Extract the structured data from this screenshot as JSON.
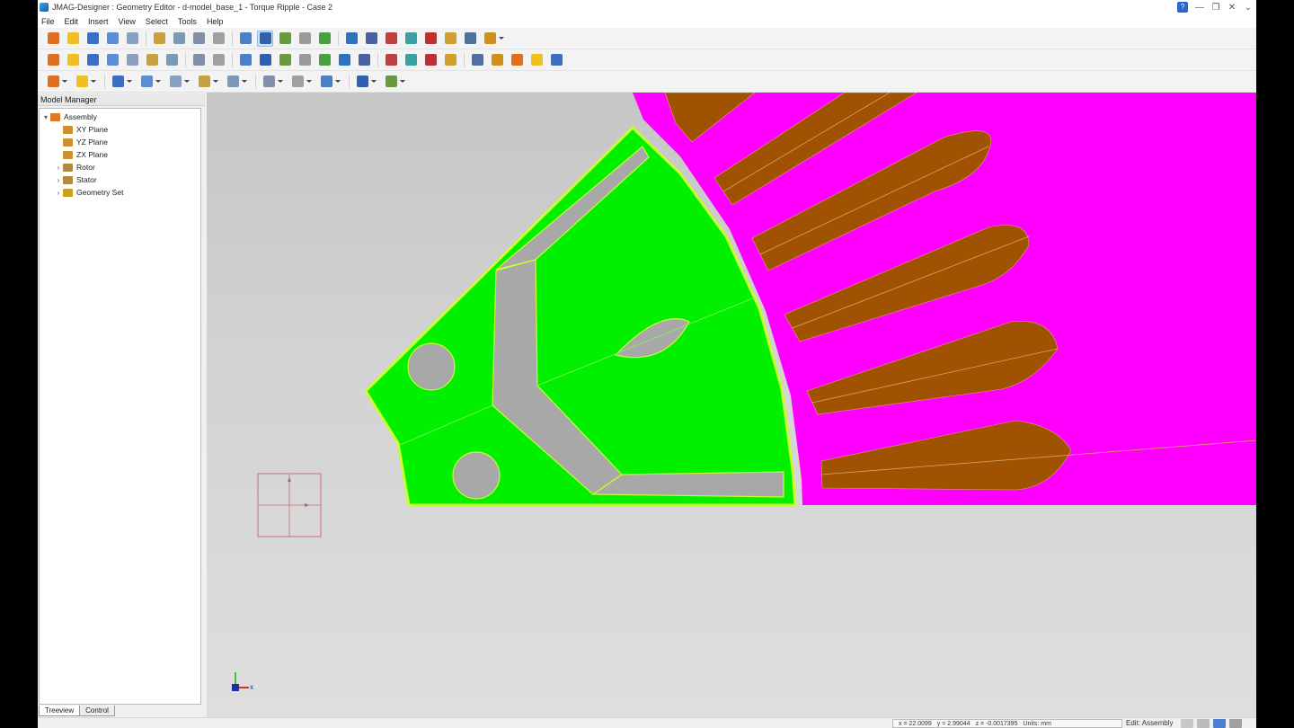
{
  "window": {
    "title": "JMAG-Designer : Geometry Editor - d-model_base_1 - Torque Ripple - Case 2",
    "controls": [
      "minimize",
      "maximize",
      "close",
      "more"
    ]
  },
  "menu": [
    "File",
    "Edit",
    "Insert",
    "View",
    "Select",
    "Tools",
    "Help"
  ],
  "toolbars": {
    "row1": [
      "back-icon",
      "open-icon",
      "save-icon",
      "undo-icon",
      "redo-icon",
      "cut-icon",
      "copy-icon",
      "paste-icon",
      "delete-icon",
      "fit-view-icon",
      "select-arrow-icon",
      "zoom-in-icon",
      "zoom-box-icon",
      "rotate-icon",
      "pan-icon",
      "zoom-icon",
      "grid-icon",
      "snap-icon",
      "search-icon",
      "settings-icon",
      "window-icon",
      "display-mode-icon"
    ],
    "row2": [
      "view-iso-1-icon",
      "view-iso-2-icon",
      "view-iso-3-icon",
      "view-iso-4-icon",
      "view-iso-5-icon",
      "view-iso-6-icon",
      "view-iso-7-icon",
      "view-front-icon",
      "view-down-icon",
      "solid-icon",
      "wire-icon",
      "hidden-line-icon",
      "shade-1-icon",
      "shade-2-icon",
      "shade-3-icon",
      "shade-4-icon",
      "layer-icon",
      "node-icon",
      "edge-icon",
      "face-icon",
      "mesh-1-icon",
      "mesh-2-icon",
      "warning-icon",
      "warning-2-icon",
      "export-icon"
    ],
    "row3": [
      "part-icon",
      "brush-icon",
      "extrude-icon",
      "chart-icon",
      "pattern-icon",
      "cloud-icon",
      "tool-icon",
      "line-icon",
      "point-icon",
      "group-icon",
      "globe-icon",
      "measure-icon"
    ]
  },
  "model_manager": {
    "title": "Model Manager",
    "tree": [
      {
        "label": "Assembly",
        "icon": "assembly-icon",
        "expander": "▾",
        "level": 0
      },
      {
        "label": "XY Plane",
        "icon": "plane-icon",
        "expander": "",
        "level": 1
      },
      {
        "label": "YZ Plane",
        "icon": "plane-icon",
        "expander": "",
        "level": 1
      },
      {
        "label": "ZX Plane",
        "icon": "plane-icon",
        "expander": "",
        "level": 1
      },
      {
        "label": "Rotor",
        "icon": "part-icon",
        "expander": "›",
        "level": 1
      },
      {
        "label": "Stator",
        "icon": "part-icon",
        "expander": "›",
        "level": 1
      },
      {
        "label": "Geometry Set",
        "icon": "geometry-set-icon",
        "expander": "›",
        "level": 1
      }
    ],
    "tabs": [
      "Treeview",
      "Control"
    ]
  },
  "viewport": {
    "colors": {
      "rotor_core": "#00f000",
      "rotor_outline": "#c8ff30",
      "stator_core": "#ff00ff",
      "coil": "#a05200",
      "magnet": "#a8a8a8",
      "background": "#d0d0d0"
    }
  },
  "status": {
    "x": "x = 22.0099",
    "y": "y = 2.99044",
    "z": "z = -0.0017395",
    "units": "Units: mm",
    "mode": "Edit: Assembly"
  }
}
